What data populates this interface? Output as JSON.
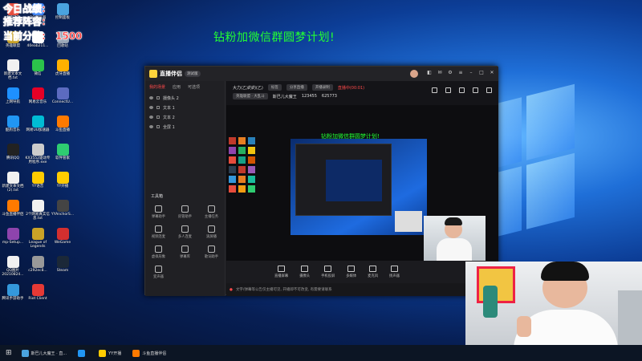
{
  "overlay": {
    "line1": "今日战绩:",
    "line2": "推荐阵容:",
    "line3_label": "当前分数:",
    "line3_value": "1500"
  },
  "banner": "钻粉加微信群圆梦计划!",
  "desktop_icons": [
    {
      "label": "卡特兄弟",
      "color": "#e74c3c"
    },
    {
      "label": "QQ浏览器",
      "color": "#3b82f6"
    },
    {
      "label": "控制面板",
      "color": "#4aa3df"
    },
    {
      "label": "英雄联盟",
      "color": "#c9a227"
    },
    {
      "label": "40eab211...",
      "color": "#ffffff"
    },
    {
      "label": "回收站",
      "color": "#9aa7b8"
    },
    {
      "label": "新建文本文档.txt",
      "color": "#f1f1f1"
    },
    {
      "label": "微信",
      "color": "#2bc24b"
    },
    {
      "label": "虎牙直播",
      "color": "#ffb100"
    },
    {
      "label": "上网导航",
      "color": "#1e90ff"
    },
    {
      "label": "网易云音乐",
      "color": "#e60026"
    },
    {
      "label": "ConnectU...",
      "color": "#5c6bc0"
    },
    {
      "label": "酷狗音乐",
      "color": "#2196f3"
    },
    {
      "label": "网易UU加速器",
      "color": "#00bcd4"
    },
    {
      "label": "斗鱼直播",
      "color": "#ff7a00"
    },
    {
      "label": "腾讯QQ",
      "color": "#222222"
    },
    {
      "label": "KX3552驱动专用程序.exe",
      "color": "#cccccc"
    },
    {
      "label": "软件管家",
      "color": "#2ecc71"
    },
    {
      "label": "新建文本文档(2).txt",
      "color": "#f1f1f1"
    },
    {
      "label": "YY语音",
      "color": "#ffcc00"
    },
    {
      "label": "YY开播",
      "color": "#ffcc00"
    },
    {
      "label": "斗鱼直播伴侣",
      "color": "#ff7a00"
    },
    {
      "label": "2个网易真实信息.txt",
      "color": "#f1f1f1"
    },
    {
      "label": "YYAnchorS...",
      "color": "#444"
    },
    {
      "label": "mp-Setup...",
      "color": "#8e44ad"
    },
    {
      "label": "League of Legends",
      "color": "#c9a227"
    },
    {
      "label": "WeGame",
      "color": "#d32f2f"
    },
    {
      "label": "QQ图片20210824...",
      "color": "#f1f1f1"
    },
    {
      "label": "c292ec8...",
      "color": "#999"
    },
    {
      "label": "Steam",
      "color": "#1b2838"
    },
    {
      "label": "腾讯手游助手",
      "color": "#3498db"
    },
    {
      "label": "Riot Client",
      "color": "#e53935"
    }
  ],
  "app": {
    "name": "直播伴侣",
    "version": "测试版",
    "tabs": [
      "我的场景",
      "应用",
      "可选项"
    ],
    "active_tab": 0,
    "scenes": [
      "摄像头 2",
      "文本 1",
      "文本 2",
      "全屏 1"
    ],
    "tools_title": "工具箱",
    "tools": [
      "弹幕助手",
      "房管助手",
      "主播任务",
      "视频连麦",
      "多人连麦",
      "滚屏播",
      "虚拟形象",
      "弹幕库",
      "歌词助手",
      "变声器"
    ],
    "room_title": "大力(乙)的的(乙)",
    "room_tags": [
      "标签",
      "分享直播",
      "开播录制"
    ],
    "room_status": "直播中(00:01)",
    "category": "英雄联盟 · 大乱斗",
    "room_label": "斯巴儿大魔王",
    "room_id": "123455",
    "fans": "625773",
    "bottom_actions": [
      "直播屏幕",
      "摄像头",
      "手机投屏",
      "多媒体",
      "麦克风",
      "扬声器"
    ],
    "status_text": "文字/弹幕等公告仅主播可见, 开播即不可改变, 有需要请联系",
    "left_status": "设置",
    "inner_banner": "钻粉加微信群圆梦计划!"
  },
  "taskbar": {
    "items": [
      {
        "label": "斯巴儿大魔王 · 直...",
        "color": "#4aa3df"
      },
      {
        "label": "",
        "color": "#2196f3"
      },
      {
        "label": "YY开播",
        "color": "#ffcc00"
      },
      {
        "label": "斗鱼直播伴侣",
        "color": "#ff7a00"
      }
    ]
  }
}
